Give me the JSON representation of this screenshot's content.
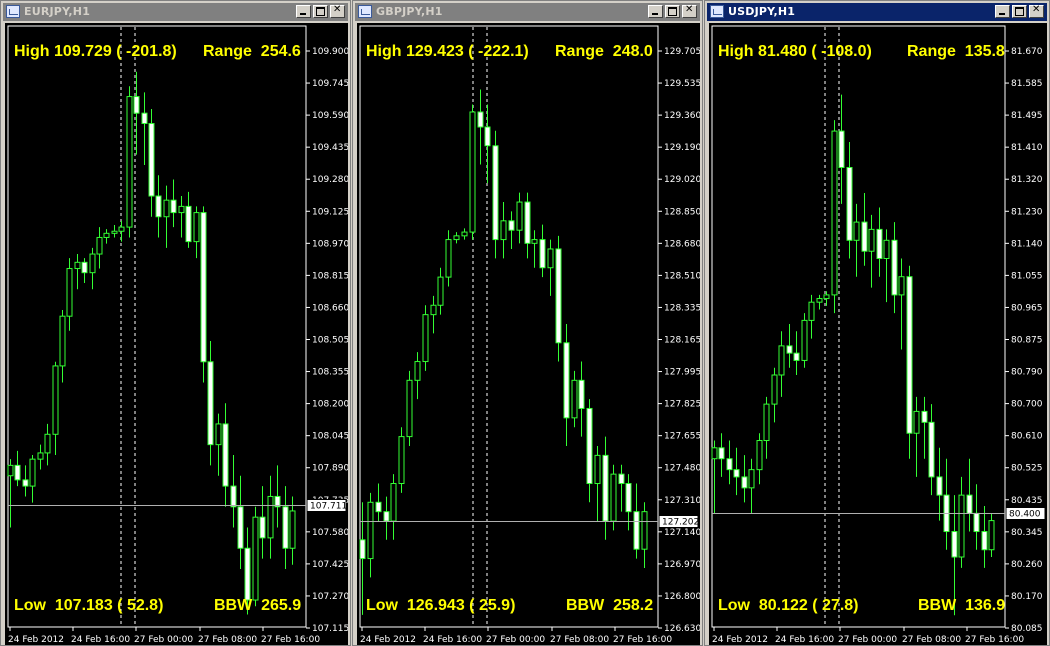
{
  "windows": [
    {
      "title": "EURJPY,H1",
      "active": false,
      "stats": {
        "high": "High 109.729 ( -201.8)",
        "range": "Range  254.6",
        "low": "Low  107.183 ( 52.8)",
        "bbw": "BBW  265.9"
      },
      "price_axis": [
        "109.900",
        "109.745",
        "109.590",
        "109.435",
        "109.280",
        "109.125",
        "108.970",
        "108.815",
        "108.660",
        "108.505",
        "108.355",
        "108.200",
        "108.045",
        "107.890",
        "107.735",
        "107.580",
        "107.425",
        "107.270",
        "107.115"
      ],
      "current_price": "107.711",
      "time_labels": [
        "24 Feb 2012",
        "24 Feb 16:00",
        "27 Feb 00:00",
        "27 Feb 08:00",
        "27 Feb 16:00"
      ]
    },
    {
      "title": "GBPJPY,H1",
      "active": false,
      "stats": {
        "high": "High 129.423 ( -222.1)",
        "range": "Range  248.0",
        "low": "Low  126.943 ( 25.9)",
        "bbw": "BBW  258.2"
      },
      "price_axis": [
        "129.705",
        "129.535",
        "129.360",
        "129.190",
        "129.020",
        "128.850",
        "128.680",
        "128.510",
        "128.335",
        "128.165",
        "127.995",
        "127.825",
        "127.655",
        "127.480",
        "127.310",
        "127.140",
        "126.970",
        "126.800",
        "126.630"
      ],
      "current_price": "127.202",
      "time_labels": [
        "24 Feb 2012",
        "24 Feb 16:00",
        "27 Feb 00:00",
        "27 Feb 08:00",
        "27 Feb 16:00"
      ]
    },
    {
      "title": "USDJPY,H1",
      "active": true,
      "stats": {
        "high": "High 81.480 ( -108.0)",
        "range": "Range  135.8",
        "low": "Low  80.122 ( 27.8)",
        "bbw": "BBW  136.9"
      },
      "price_axis": [
        "81.670",
        "81.585",
        "81.495",
        "81.410",
        "81.320",
        "81.230",
        "81.140",
        "81.055",
        "80.965",
        "80.875",
        "80.790",
        "80.700",
        "80.610",
        "80.525",
        "80.435",
        "80.345",
        "80.260",
        "80.170",
        "80.085"
      ],
      "current_price": "80.400",
      "time_labels": [
        "24 Feb 2012",
        "24 Feb 16:00",
        "27 Feb 00:00",
        "27 Feb 08:00",
        "27 Feb 16:00"
      ]
    }
  ],
  "chart_data": [
    {
      "type": "candlestick",
      "title": "EURJPY,H1",
      "ylim": [
        107.115,
        109.9
      ],
      "current": 107.711,
      "candles": [
        [
          107.85,
          107.93,
          107.6,
          107.9
        ],
        [
          107.9,
          107.97,
          107.8,
          107.83
        ],
        [
          107.83,
          107.9,
          107.75,
          107.8
        ],
        [
          107.8,
          107.95,
          107.72,
          107.93
        ],
        [
          107.93,
          108.0,
          107.88,
          107.96
        ],
        [
          107.96,
          108.1,
          107.9,
          108.05
        ],
        [
          108.05,
          108.4,
          107.95,
          108.38
        ],
        [
          108.38,
          108.65,
          108.3,
          108.62
        ],
        [
          108.62,
          108.9,
          108.55,
          108.85
        ],
        [
          108.85,
          108.92,
          108.75,
          108.88
        ],
        [
          108.88,
          108.9,
          108.78,
          108.83
        ],
        [
          108.83,
          108.95,
          108.75,
          108.92
        ],
        [
          108.92,
          109.05,
          108.85,
          109.0
        ],
        [
          109.0,
          109.04,
          108.97,
          109.02
        ],
        [
          109.02,
          109.06,
          109.0,
          109.03
        ],
        [
          109.03,
          109.08,
          108.98,
          109.05
        ],
        [
          109.05,
          109.73,
          109.0,
          109.68
        ],
        [
          109.68,
          109.8,
          109.4,
          109.6
        ],
        [
          109.6,
          109.7,
          109.35,
          109.55
        ],
        [
          109.55,
          109.62,
          109.1,
          109.2
        ],
        [
          109.2,
          109.3,
          109.0,
          109.1
        ],
        [
          109.1,
          109.25,
          108.95,
          109.18
        ],
        [
          109.18,
          109.28,
          109.05,
          109.12
        ],
        [
          109.12,
          109.2,
          109.0,
          109.15
        ],
        [
          109.15,
          109.22,
          108.95,
          108.98
        ],
        [
          108.98,
          109.15,
          108.9,
          109.12
        ],
        [
          109.12,
          109.15,
          108.3,
          108.4
        ],
        [
          108.4,
          108.5,
          107.9,
          108.0
        ],
        [
          108.0,
          108.15,
          107.85,
          108.1
        ],
        [
          108.1,
          108.2,
          107.7,
          107.8
        ],
        [
          107.8,
          107.95,
          107.6,
          107.7
        ],
        [
          107.7,
          107.85,
          107.4,
          107.5
        ],
        [
          107.5,
          107.6,
          107.18,
          107.25
        ],
        [
          107.25,
          107.7,
          107.22,
          107.65
        ],
        [
          107.65,
          107.8,
          107.45,
          107.55
        ],
        [
          107.55,
          107.85,
          107.45,
          107.75
        ],
        [
          107.75,
          107.9,
          107.6,
          107.7
        ],
        [
          107.7,
          107.8,
          107.4,
          107.5
        ],
        [
          107.5,
          107.75,
          107.42,
          107.68
        ]
      ]
    },
    {
      "type": "candlestick",
      "title": "GBPJPY,H1",
      "ylim": [
        126.63,
        129.705
      ],
      "current": 127.202,
      "candles": [
        [
          127.1,
          127.3,
          126.7,
          127.0
        ],
        [
          127.0,
          127.35,
          126.9,
          127.3
        ],
        [
          127.3,
          127.4,
          127.2,
          127.25
        ],
        [
          127.25,
          127.33,
          127.1,
          127.2
        ],
        [
          127.2,
          127.45,
          127.1,
          127.4
        ],
        [
          127.4,
          127.7,
          127.35,
          127.65
        ],
        [
          127.65,
          128.0,
          127.6,
          127.95
        ],
        [
          127.95,
          128.1,
          127.85,
          128.05
        ],
        [
          128.05,
          128.35,
          128.0,
          128.3
        ],
        [
          128.3,
          128.4,
          128.2,
          128.35
        ],
        [
          128.35,
          128.55,
          128.3,
          128.5
        ],
        [
          128.5,
          128.75,
          128.45,
          128.7
        ],
        [
          128.7,
          128.74,
          128.68,
          128.72
        ],
        [
          128.72,
          128.76,
          128.7,
          128.74
        ],
        [
          128.74,
          129.42,
          128.7,
          129.38
        ],
        [
          129.38,
          129.5,
          129.1,
          129.3
        ],
        [
          129.3,
          129.42,
          129.0,
          129.2
        ],
        [
          129.2,
          129.28,
          128.6,
          128.7
        ],
        [
          128.7,
          128.9,
          128.6,
          128.8
        ],
        [
          128.8,
          128.85,
          128.65,
          128.75
        ],
        [
          128.75,
          128.95,
          128.68,
          128.9
        ],
        [
          128.9,
          128.95,
          128.6,
          128.68
        ],
        [
          128.68,
          128.75,
          128.55,
          128.7
        ],
        [
          128.7,
          128.78,
          128.5,
          128.55
        ],
        [
          128.55,
          128.7,
          128.4,
          128.65
        ],
        [
          128.65,
          128.72,
          128.05,
          128.15
        ],
        [
          128.15,
          128.25,
          127.6,
          127.75
        ],
        [
          127.75,
          128.0,
          127.7,
          127.95
        ],
        [
          127.95,
          128.05,
          127.65,
          127.8
        ],
        [
          127.8,
          127.85,
          127.3,
          127.4
        ],
        [
          127.4,
          127.6,
          127.2,
          127.55
        ],
        [
          127.55,
          127.65,
          127.1,
          127.2
        ],
        [
          127.2,
          127.5,
          127.15,
          127.45
        ],
        [
          127.45,
          127.5,
          127.25,
          127.4
        ],
        [
          127.4,
          127.45,
          127.15,
          127.25
        ],
        [
          127.25,
          127.4,
          127.0,
          127.05
        ],
        [
          127.05,
          127.3,
          126.95,
          127.25
        ]
      ]
    },
    {
      "type": "candlestick",
      "title": "USDJPY,H1",
      "ylim": [
        80.085,
        81.67
      ],
      "current": 80.4,
      "candles": [
        [
          80.55,
          80.6,
          80.4,
          80.58
        ],
        [
          80.58,
          80.62,
          80.5,
          80.55
        ],
        [
          80.55,
          80.6,
          80.48,
          80.52
        ],
        [
          80.52,
          80.58,
          80.45,
          80.5
        ],
        [
          80.5,
          80.56,
          80.43,
          80.47
        ],
        [
          80.47,
          80.55,
          80.4,
          80.52
        ],
        [
          80.52,
          80.62,
          80.48,
          80.6
        ],
        [
          80.6,
          80.72,
          80.55,
          80.7
        ],
        [
          80.7,
          80.8,
          80.65,
          80.78
        ],
        [
          80.78,
          80.9,
          80.72,
          80.86
        ],
        [
          80.86,
          80.92,
          80.8,
          80.84
        ],
        [
          80.84,
          80.9,
          80.78,
          80.82
        ],
        [
          80.82,
          80.95,
          80.8,
          80.93
        ],
        [
          80.93,
          81.0,
          80.88,
          80.98
        ],
        [
          80.98,
          81.0,
          80.96,
          80.99
        ],
        [
          80.99,
          81.01,
          80.97,
          81.0
        ],
        [
          81.0,
          81.48,
          80.95,
          81.45
        ],
        [
          81.45,
          81.55,
          81.25,
          81.35
        ],
        [
          81.35,
          81.42,
          81.1,
          81.15
        ],
        [
          81.15,
          81.25,
          81.05,
          81.2
        ],
        [
          81.2,
          81.28,
          81.08,
          81.12
        ],
        [
          81.12,
          81.22,
          81.02,
          81.18
        ],
        [
          81.18,
          81.24,
          81.05,
          81.1
        ],
        [
          81.1,
          81.18,
          80.98,
          81.15
        ],
        [
          81.15,
          81.2,
          80.95,
          81.0
        ],
        [
          81.0,
          81.1,
          80.85,
          81.05
        ],
        [
          81.05,
          81.08,
          80.55,
          80.62
        ],
        [
          80.62,
          80.72,
          80.5,
          80.68
        ],
        [
          80.68,
          80.72,
          80.55,
          80.65
        ],
        [
          80.65,
          80.7,
          80.45,
          80.5
        ],
        [
          80.5,
          80.58,
          80.38,
          80.45
        ],
        [
          80.45,
          80.55,
          80.3,
          80.35
        ],
        [
          80.35,
          80.45,
          80.12,
          80.28
        ],
        [
          80.28,
          80.5,
          80.25,
          80.45
        ],
        [
          80.45,
          80.55,
          80.35,
          80.4
        ],
        [
          80.4,
          80.48,
          80.3,
          80.35
        ],
        [
          80.35,
          80.42,
          80.25,
          80.3
        ],
        [
          80.3,
          80.4,
          80.28,
          80.38
        ]
      ]
    }
  ]
}
